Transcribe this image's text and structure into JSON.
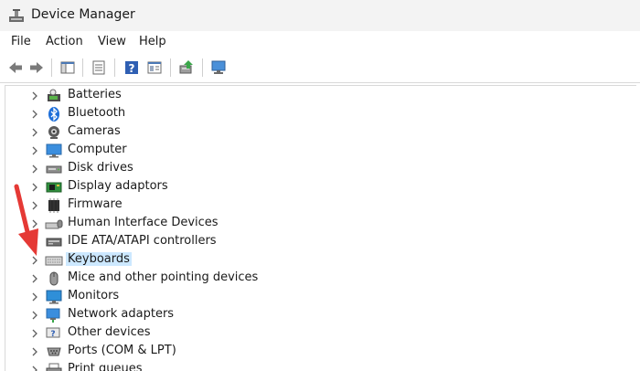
{
  "window": {
    "title": "Device Manager",
    "app_icon": "device-manager-icon"
  },
  "menu": [
    "File",
    "Action",
    "View",
    "Help"
  ],
  "toolbar": {
    "buttons": [
      "back-icon",
      "forward-icon",
      "properties-pane-icon",
      "list-view-icon",
      "help-icon",
      "details-view-icon",
      "update-driver-icon",
      "scan-hardware-icon"
    ]
  },
  "tree": {
    "items": [
      {
        "label": "Batteries",
        "icon": "battery-icon"
      },
      {
        "label": "Bluetooth",
        "icon": "bluetooth-icon"
      },
      {
        "label": "Cameras",
        "icon": "camera-icon"
      },
      {
        "label": "Computer",
        "icon": "computer-icon"
      },
      {
        "label": "Disk drives",
        "icon": "disk-drive-icon"
      },
      {
        "label": "Display adaptors",
        "icon": "display-adapter-icon"
      },
      {
        "label": "Firmware",
        "icon": "firmware-icon"
      },
      {
        "label": "Human Interface Devices",
        "icon": "hid-icon"
      },
      {
        "label": "IDE ATA/ATAPI controllers",
        "icon": "ide-controller-icon"
      },
      {
        "label": "Keyboards",
        "icon": "keyboard-icon",
        "selected": true
      },
      {
        "label": "Mice and other pointing devices",
        "icon": "mouse-icon"
      },
      {
        "label": "Monitors",
        "icon": "monitor-icon"
      },
      {
        "label": "Network adapters",
        "icon": "network-adapter-icon"
      },
      {
        "label": "Other devices",
        "icon": "other-devices-icon"
      },
      {
        "label": "Ports (COM & LPT)",
        "icon": "ports-icon"
      },
      {
        "label": "Print queues",
        "icon": "printer-icon"
      }
    ]
  },
  "annotation": {
    "icon": "red-arrow-icon",
    "color": "#e53935"
  },
  "colors": {
    "selection": "#cce8ff",
    "accent": "#0067c0"
  }
}
